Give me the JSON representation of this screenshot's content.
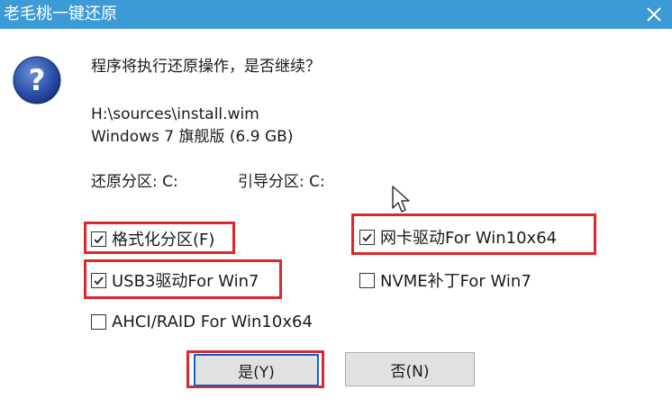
{
  "window": {
    "title": "老毛桃一键还原"
  },
  "icons": {
    "close": "close-icon",
    "question": "question-icon",
    "check": "check-icon",
    "cursor": "mouse-cursor-icon"
  },
  "colors": {
    "titlebar": "#3c9bd6",
    "highlight": "#e0272b",
    "primary_border": "#0a64c8"
  },
  "dialog": {
    "prompt": "程序将执行还原操作，是否继续？",
    "file_path": "H:\\sources\\install.wim",
    "edition": "Windows 7 旗舰版 (6.9 GB)",
    "restore_partition": "还原分区: C:",
    "boot_partition": "引导分区: C:"
  },
  "options": {
    "format_partition": {
      "label": "格式化分区(F)",
      "checked": true
    },
    "nic_driver": {
      "label": "网卡驱动For Win10x64",
      "checked": true
    },
    "usb3_driver": {
      "label": "USB3驱动For Win7",
      "checked": true
    },
    "nvme_patch": {
      "label": "NVME补丁For Win7",
      "checked": false
    },
    "ahci_raid": {
      "label": "AHCI/RAID For Win10x64",
      "checked": false
    }
  },
  "buttons": {
    "yes": "是(Y)",
    "no": "否(N)"
  }
}
